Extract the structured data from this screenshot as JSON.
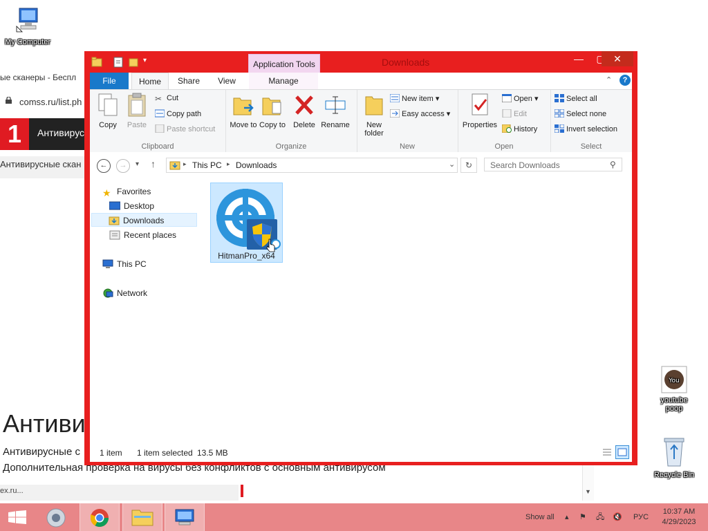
{
  "browser": {
    "tab_label": "ые сканеры - Беспл",
    "address": "comss.ru/list.ph",
    "site_logo": "1",
    "site_title": "Антивирус",
    "breadcrumb": "Антивирусные скан",
    "heading": "Антиви",
    "para1": "Антивирусные с",
    "para2": "Дополнительная проверка на вирусы без конфликтов с основным антивирусом",
    "status": "ex.ru..."
  },
  "desktop": {
    "my_computer": "My Computer",
    "youtube": "youtube poop",
    "recycle_bin": "Recycle Bin"
  },
  "window": {
    "title": "Downloads",
    "app_tools": "Application Tools",
    "tabs": {
      "file": "File",
      "home": "Home",
      "share": "Share",
      "view": "View",
      "manage": "Manage"
    },
    "clipboard": {
      "label": "Clipboard",
      "copy": "Copy",
      "paste": "Paste",
      "cut": "Cut",
      "copy_path": "Copy path",
      "paste_shortcut": "Paste shortcut"
    },
    "organize": {
      "label": "Organize",
      "move_to": "Move to",
      "copy_to": "Copy to",
      "delete": "Delete",
      "rename": "Rename"
    },
    "new": {
      "label": "New",
      "new_folder_1": "New",
      "new_folder_2": "folder",
      "new_item": "New item",
      "easy_access": "Easy access"
    },
    "open": {
      "label": "Open",
      "properties": "Properties",
      "open": "Open",
      "edit": "Edit",
      "history": "History"
    },
    "select": {
      "label": "Select",
      "select_all": "Select all",
      "select_none": "Select none",
      "invert": "Invert selection"
    },
    "path": {
      "this_pc": "This PC",
      "downloads": "Downloads"
    },
    "search_placeholder": "Search Downloads",
    "nav": {
      "favorites": "Favorites",
      "desktop": "Desktop",
      "downloads": "Downloads",
      "recent": "Recent places",
      "this_pc": "This PC",
      "network": "Network"
    },
    "file": {
      "name": "HitmanPro_x64"
    },
    "status": {
      "count": "1 item",
      "selected": "1 item selected",
      "size": "13.5 MB"
    }
  },
  "taskbar": {
    "show_all": "Show all",
    "lang": "РУС",
    "time": "10:37 AM",
    "date": "4/29/2023"
  },
  "colors": {
    "accent": "#e81f1f",
    "file_tab": "#1979ca",
    "taskbar": "#e88688"
  }
}
